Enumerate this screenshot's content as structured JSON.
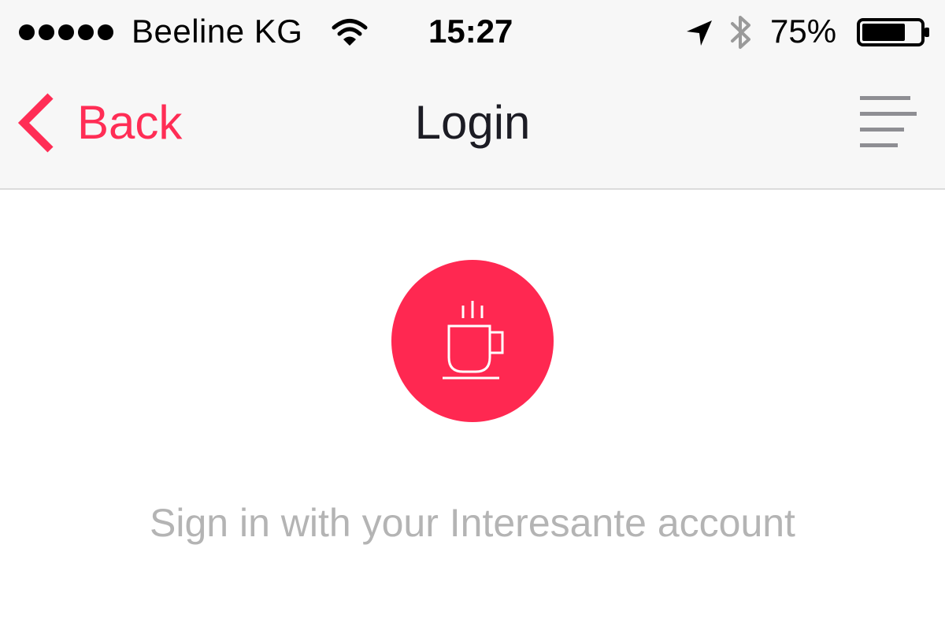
{
  "status_bar": {
    "signal_icon": "signal-dots-icon",
    "signal_bars": 5,
    "carrier": "Beeline KG",
    "wifi_icon": "wifi-icon",
    "time": "15:27",
    "location_icon": "location-arrow-icon",
    "bluetooth_icon": "bluetooth-icon",
    "battery_percent": "75%",
    "battery_level": 0.75,
    "battery_icon": "battery-icon"
  },
  "nav": {
    "back_icon": "chevron-left-icon",
    "back_label": "Back",
    "title": "Login",
    "menu_icon": "menu-lines-icon"
  },
  "content": {
    "logo_icon": "coffee-cup-icon",
    "subtitle": "Sign in with your Interesante account"
  },
  "colors": {
    "accent": "#ff2d55",
    "logo_background": "#ff2851",
    "nav_background": "#f7f7f7",
    "title_text": "#1c1c24",
    "subtitle_text": "#b4b4b4",
    "menu_icon": "#8e8e93"
  }
}
